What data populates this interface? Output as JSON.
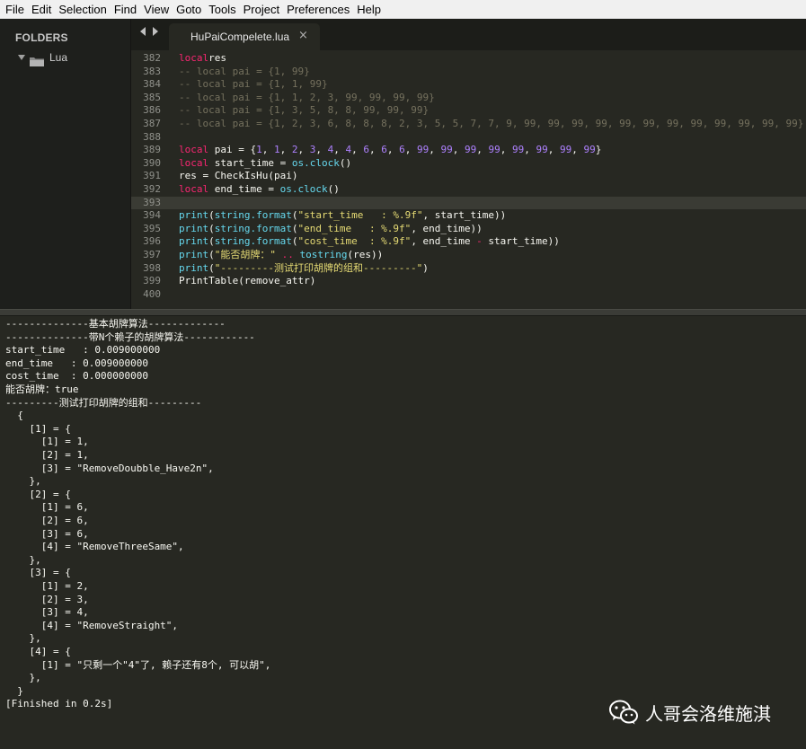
{
  "menu": [
    "File",
    "Edit",
    "Selection",
    "Find",
    "View",
    "Goto",
    "Tools",
    "Project",
    "Preferences",
    "Help"
  ],
  "sidebar": {
    "title": "FOLDERS",
    "folder": "Lua"
  },
  "tabs": {
    "active_label": "HuPaiCompelete.lua",
    "close_glyph": "×"
  },
  "editor": {
    "current_line": 393,
    "lines": [
      {
        "n": "382",
        "tokens": [
          [
            "kw",
            "local"
          ],
          [
            "",
            "res"
          ]
        ]
      },
      {
        "n": "383",
        "tokens": [
          [
            "cm",
            "-- local pai = {1, 99}"
          ]
        ]
      },
      {
        "n": "384",
        "tokens": [
          [
            "cm",
            "-- local pai = {1, 1, 99}"
          ]
        ]
      },
      {
        "n": "385",
        "tokens": [
          [
            "cm",
            "-- local pai = {1, 1, 2, 3, 99, 99, 99, 99}"
          ]
        ]
      },
      {
        "n": "386",
        "tokens": [
          [
            "cm",
            "-- local pai = {1, 3, 5, 8, 8, 99, 99, 99}"
          ]
        ]
      },
      {
        "n": "387",
        "tokens": [
          [
            "cm",
            "-- local pai = {1, 2, 3, 6, 8, 8, 8, 2, 3, 5, 5, 7, 7, 9, 99, 99, 99, 99, 99, 99, 99, 99, 99, 99, 99, 99}"
          ]
        ]
      },
      {
        "n": "388",
        "tokens": []
      },
      {
        "n": "389",
        "tokens": [
          [
            "kw",
            "local"
          ],
          [
            "",
            " pai = {"
          ],
          [
            "num",
            "1"
          ],
          [
            "",
            ", "
          ],
          [
            "num",
            "1"
          ],
          [
            "",
            ", "
          ],
          [
            "num",
            "2"
          ],
          [
            "",
            ", "
          ],
          [
            "num",
            "3"
          ],
          [
            "",
            ", "
          ],
          [
            "num",
            "4"
          ],
          [
            "",
            ", "
          ],
          [
            "num",
            "4"
          ],
          [
            "",
            ", "
          ],
          [
            "num",
            "6"
          ],
          [
            "",
            ", "
          ],
          [
            "num",
            "6"
          ],
          [
            "",
            ", "
          ],
          [
            "num",
            "6"
          ],
          [
            "",
            ", "
          ],
          [
            "num",
            "99"
          ],
          [
            "",
            ", "
          ],
          [
            "num",
            "99"
          ],
          [
            "",
            ", "
          ],
          [
            "num",
            "99"
          ],
          [
            "",
            ", "
          ],
          [
            "num",
            "99"
          ],
          [
            "",
            ", "
          ],
          [
            "num",
            "99"
          ],
          [
            "",
            ", "
          ],
          [
            "num",
            "99"
          ],
          [
            "",
            ", "
          ],
          [
            "num",
            "99"
          ],
          [
            "",
            ", "
          ],
          [
            "num",
            "99"
          ],
          [
            "",
            "}"
          ]
        ]
      },
      {
        "n": "390",
        "tokens": [
          [
            "kw",
            "local"
          ],
          [
            "",
            " start_time = "
          ],
          [
            "fn",
            "os.clock"
          ],
          [
            "",
            "()"
          ]
        ]
      },
      {
        "n": "391",
        "tokens": [
          [
            "",
            "res = CheckIsHu(pai)"
          ]
        ]
      },
      {
        "n": "392",
        "tokens": [
          [
            "kw",
            "local"
          ],
          [
            "",
            " end_time = "
          ],
          [
            "fn",
            "os.clock"
          ],
          [
            "",
            "()"
          ]
        ]
      },
      {
        "n": "393",
        "tokens": []
      },
      {
        "n": "394",
        "tokens": [
          [
            "fn",
            "print"
          ],
          [
            "",
            "("
          ],
          [
            "fn",
            "string.format"
          ],
          [
            "",
            "("
          ],
          [
            "str",
            "\"start_time   : %.9f\""
          ],
          [
            "",
            ", start_time))"
          ]
        ]
      },
      {
        "n": "395",
        "tokens": [
          [
            "fn",
            "print"
          ],
          [
            "",
            "("
          ],
          [
            "fn",
            "string.format"
          ],
          [
            "",
            "("
          ],
          [
            "str",
            "\"end_time   : %.9f\""
          ],
          [
            "",
            ", end_time))"
          ]
        ]
      },
      {
        "n": "396",
        "tokens": [
          [
            "fn",
            "print"
          ],
          [
            "",
            "("
          ],
          [
            "fn",
            "string.format"
          ],
          [
            "",
            "("
          ],
          [
            "str",
            "\"cost_time  : %.9f\""
          ],
          [
            "",
            ", end_time "
          ],
          [
            "kw",
            "-"
          ],
          [
            "",
            " start_time))"
          ]
        ]
      },
      {
        "n": "397",
        "tokens": [
          [
            "fn",
            "print"
          ],
          [
            "",
            "("
          ],
          [
            "str",
            "\"能否胡牌：\""
          ],
          [
            "",
            " "
          ],
          [
            "kw",
            ".."
          ],
          [
            "",
            " "
          ],
          [
            "fn",
            "tostring"
          ],
          [
            "",
            "(res))"
          ]
        ]
      },
      {
        "n": "398",
        "tokens": [
          [
            "fn",
            "print"
          ],
          [
            "",
            "("
          ],
          [
            "str",
            "\"---------测试打印胡牌的组和---------\""
          ],
          [
            "",
            ")"
          ]
        ]
      },
      {
        "n": "399",
        "tokens": [
          [
            "",
            "PrintTable(remove_attr)"
          ]
        ]
      },
      {
        "n": "400",
        "tokens": []
      }
    ]
  },
  "output": {
    "lines": [
      "--------------基本胡牌算法-------------",
      "--------------带N个赖子的胡牌算法------------",
      "start_time   : 0.009000000",
      "end_time   : 0.009000000",
      "cost_time  : 0.000000000",
      "能否胡牌：true",
      "---------测试打印胡牌的组和---------",
      "  {",
      "    [1] = {",
      "      [1] = 1,",
      "      [2] = 1,",
      "      [3] = \"RemoveDoubble_Have2n\",",
      "    },",
      "    [2] = {",
      "      [1] = 6,",
      "      [2] = 6,",
      "      [3] = 6,",
      "      [4] = \"RemoveThreeSame\",",
      "    },",
      "    [3] = {",
      "      [1] = 2,",
      "      [2] = 3,",
      "      [3] = 4,",
      "      [4] = \"RemoveStraight\",",
      "    },",
      "    [4] = {",
      "      [1] = \"只剩一个\"4\"了, 赖子还有8个, 可以胡\",",
      "    },",
      "  }",
      "[Finished in 0.2s]"
    ]
  },
  "watermark": {
    "text": "人哥会洛维施淇",
    "icon": "wechat-icon"
  },
  "colors": {
    "keyword": "#f92672",
    "comment": "#75715e",
    "number": "#ae81ff",
    "string": "#e6db74",
    "function": "#66d9ef",
    "text": "#f8f8f2",
    "background": "#272822"
  }
}
